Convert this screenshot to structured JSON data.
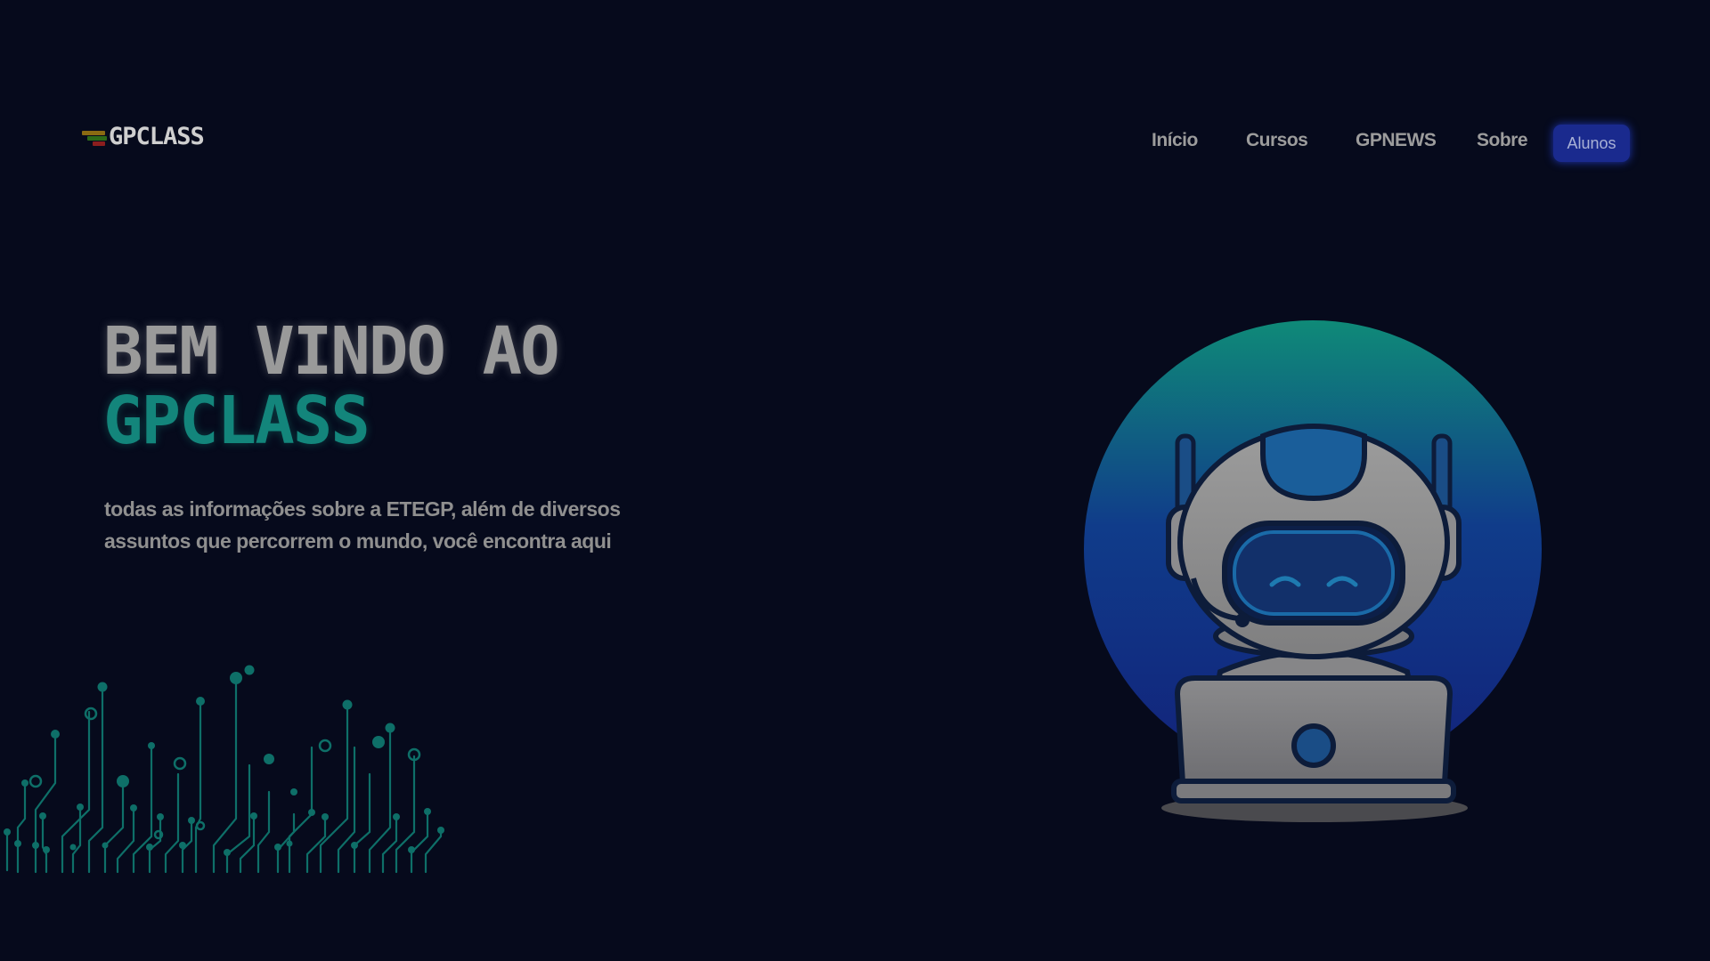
{
  "header": {
    "logo_text": "GPCLASS",
    "nav": {
      "inicio": "Início",
      "cursos": "Cursos",
      "gpnews": "GPNEWS",
      "sobre": "Sobre",
      "alunos": "Alunos"
    }
  },
  "hero": {
    "title_line1": "BEM VINDO AO",
    "title_line2": "GPCLASS",
    "subtitle_line1": "todas as informações sobre a ETEGP, além de diversos",
    "subtitle_line2": "assuntos que percorrem o mundo, você encontra aqui"
  },
  "colors": {
    "background": "#060a1c",
    "accent_teal": "#13857b",
    "accent_blue": "#1a2a8e"
  },
  "icons": {
    "logo": "gpclass-logo-icon",
    "circuit": "circuit-decoration-icon",
    "robot": "robot-laptop-illustration-icon"
  }
}
